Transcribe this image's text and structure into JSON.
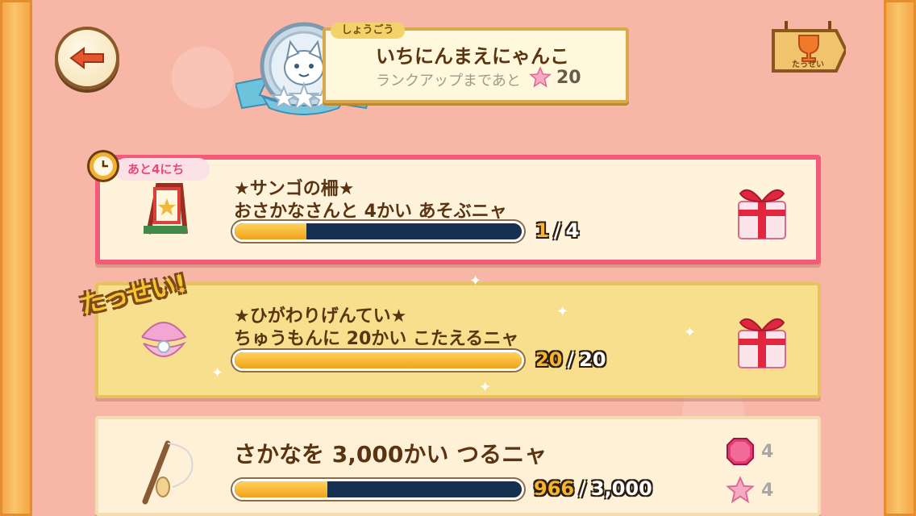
{
  "header": {
    "title_tag": "しょうごう",
    "title": "いちにんまえにゃんこ",
    "rank_up_text": "ランクアップまであと",
    "rank_up_value": "20",
    "achievement_label": "たっせい"
  },
  "missions": [
    {
      "timer_text": "あと4にち",
      "title": "★サンゴの柵★",
      "description": "おさかなさんと 4かい あそぶニャ",
      "current": "1",
      "total": "4",
      "progress": 0.25
    },
    {
      "status": "たっせい!",
      "title": "★ひがわりげんてい★",
      "description": "ちゅうもんに 20かい こたえるニャ",
      "current": "20",
      "total": "20",
      "progress": 1.0
    },
    {
      "description": "さかなを 3,000かい つるニャ",
      "current": "966",
      "total": "3,000",
      "progress": 0.322,
      "rewards": [
        {
          "icon": "gem-icon",
          "value": "4"
        },
        {
          "icon": "star-icon",
          "value": "4"
        }
      ]
    }
  ],
  "colors": {
    "card_active_border": "#f35b78",
    "card_complete_bg": "#f7df8e",
    "progress_fill": "#f2a21b",
    "progress_empty": "#163150",
    "text_brown": "#5a3411"
  }
}
